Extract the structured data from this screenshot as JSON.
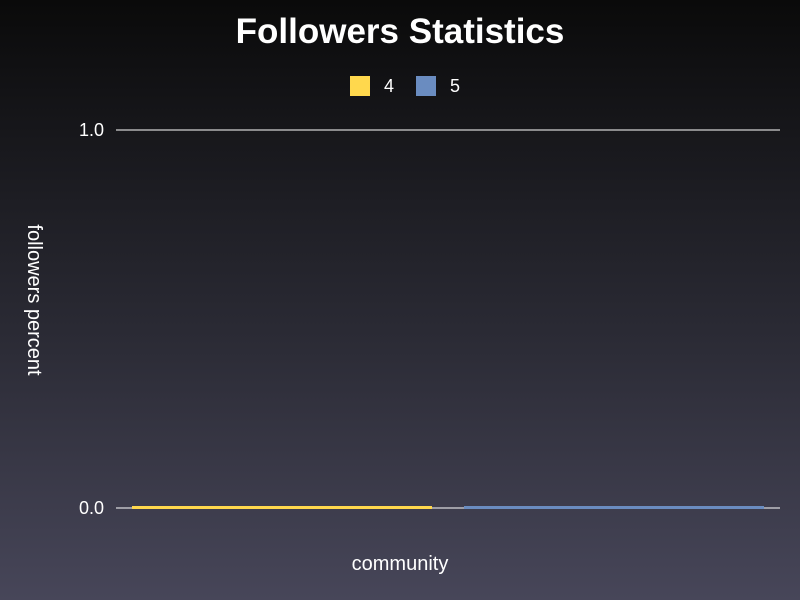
{
  "chart_data": {
    "type": "bar",
    "title": "Followers Statistics",
    "xlabel": "community",
    "ylabel": "followers percent",
    "categories": [
      ""
    ],
    "series": [
      {
        "name": "4",
        "values": [
          0.0
        ],
        "color": "#ffd84d"
      },
      {
        "name": "5",
        "values": [
          0.0
        ],
        "color": "#6a8cc0"
      }
    ],
    "ylim": [
      0.0,
      1.0
    ],
    "yticks": [
      "0.0",
      "1.0"
    ],
    "grid": true,
    "legend_position": "top-center",
    "colors": {
      "background_top": "#0a0a0a",
      "background_bottom": "#474659",
      "grid": "#ffffff",
      "text": "#ffffff"
    }
  }
}
